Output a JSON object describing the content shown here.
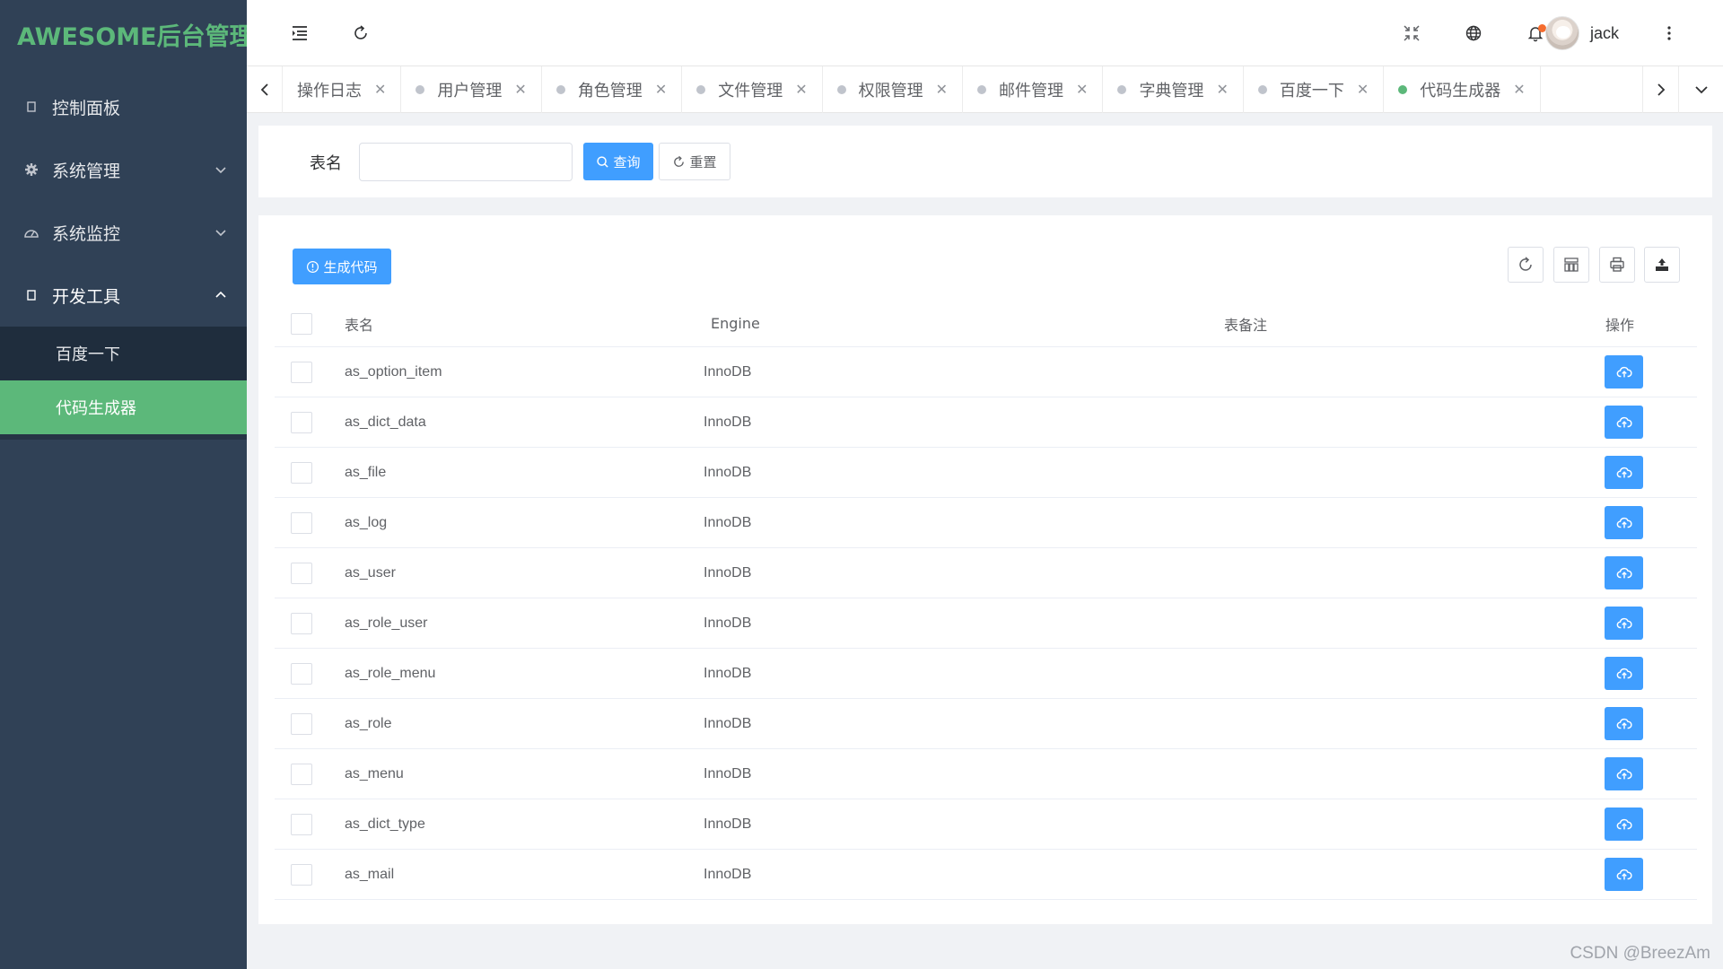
{
  "app": {
    "title": "AWESOME后台管理"
  },
  "sidebar": {
    "items": [
      {
        "label": "控制面板",
        "icon": "square-icon"
      },
      {
        "label": "系统管理",
        "icon": "gear-icon"
      },
      {
        "label": "系统监控",
        "icon": "gauge-icon"
      },
      {
        "label": "开发工具",
        "icon": "square-icon"
      }
    ],
    "subitems": [
      {
        "label": "百度一下"
      },
      {
        "label": "代码生成器"
      }
    ]
  },
  "header": {
    "user_name": "jack"
  },
  "tags": [
    {
      "label": "操作日志"
    },
    {
      "label": "用户管理"
    },
    {
      "label": "角色管理"
    },
    {
      "label": "文件管理"
    },
    {
      "label": "权限管理"
    },
    {
      "label": "邮件管理"
    },
    {
      "label": "字典管理"
    },
    {
      "label": "百度一下"
    },
    {
      "label": "代码生成器"
    }
  ],
  "query": {
    "table_name_label": "表名",
    "table_name_value": "",
    "search_label": "查询",
    "reset_label": "重置"
  },
  "toolbar": {
    "generate_label": "生成代码"
  },
  "table": {
    "headers": {
      "name": "表名",
      "engine": "Engine",
      "remark": "表备注",
      "op": "操作"
    },
    "rows": [
      {
        "name": "as_option_item",
        "engine": "InnoDB",
        "remark": ""
      },
      {
        "name": "as_dict_data",
        "engine": "InnoDB",
        "remark": ""
      },
      {
        "name": "as_file",
        "engine": "InnoDB",
        "remark": ""
      },
      {
        "name": "as_log",
        "engine": "InnoDB",
        "remark": ""
      },
      {
        "name": "as_user",
        "engine": "InnoDB",
        "remark": ""
      },
      {
        "name": "as_role_user",
        "engine": "InnoDB",
        "remark": ""
      },
      {
        "name": "as_role_menu",
        "engine": "InnoDB",
        "remark": ""
      },
      {
        "name": "as_role",
        "engine": "InnoDB",
        "remark": ""
      },
      {
        "name": "as_menu",
        "engine": "InnoDB",
        "remark": ""
      },
      {
        "name": "as_dict_type",
        "engine": "InnoDB",
        "remark": ""
      },
      {
        "name": "as_mail",
        "engine": "InnoDB",
        "remark": ""
      }
    ]
  },
  "watermark": "CSDN @BreezAm",
  "colors": {
    "brand": "#5cb87a",
    "primary": "#409eff",
    "sidebar": "#304156"
  }
}
